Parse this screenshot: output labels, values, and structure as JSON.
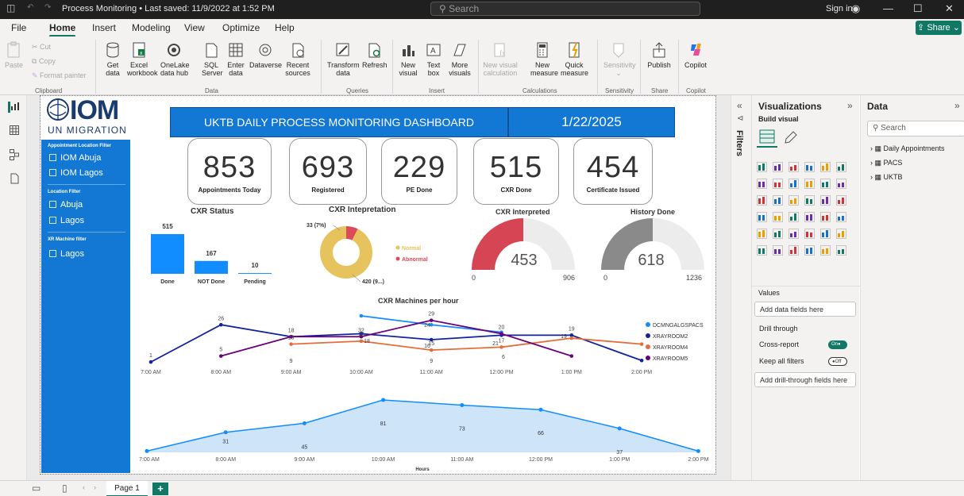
{
  "titlebar": {
    "title": "Process Monitoring • Last saved: 11/9/2022 at 1:52 PM",
    "search_placeholder": "Search",
    "sign_in": "Sign in"
  },
  "menu": {
    "items": [
      "File",
      "Home",
      "Insert",
      "Modeling",
      "View",
      "Optimize",
      "Help"
    ],
    "active": "Home",
    "share_label": "Share"
  },
  "ribbon": {
    "clipboard": {
      "paste": "Paste",
      "cut": "Cut",
      "copy": "Copy",
      "format_painter": "Format painter",
      "group": "Clipboard"
    },
    "data": {
      "get_data": [
        "Get",
        "data"
      ],
      "excel": [
        "Excel",
        "workbook"
      ],
      "onelake": [
        "OneLake",
        "data hub"
      ],
      "sql": [
        "SQL",
        "Server"
      ],
      "enter": [
        "Enter",
        "data"
      ],
      "dataverse": [
        "Dataverse",
        ""
      ],
      "recent": [
        "Recent",
        "sources"
      ],
      "group": "Data"
    },
    "queries": {
      "transform": [
        "Transform",
        "data"
      ],
      "refresh": [
        "Refresh",
        ""
      ],
      "group": "Queries"
    },
    "insert": {
      "new_visual": [
        "New",
        "visual"
      ],
      "text_box": [
        "Text",
        "box"
      ],
      "more_visuals": [
        "More",
        "visuals"
      ],
      "group": "Insert"
    },
    "calculations": {
      "new_visual_calc": [
        "New visual",
        "calculation"
      ],
      "new_measure": [
        "New",
        "measure"
      ],
      "quick_measure": [
        "Quick",
        "measure"
      ],
      "group": "Calculations"
    },
    "sensitivity": {
      "label": [
        "Sensitivity",
        ""
      ],
      "group": "Sensitivity"
    },
    "share": {
      "publish": [
        "Publish",
        ""
      ],
      "group": "Share"
    },
    "copilot": {
      "label": [
        "Copilot",
        ""
      ],
      "group": "Copilot"
    }
  },
  "report": {
    "logo": {
      "brand": "IOM",
      "sub": "UN MIGRATION"
    },
    "header": {
      "title": "UKTB DAILY PROCESS MONITORING DASHBOARD",
      "date": "1/22/2025"
    },
    "slicers": [
      {
        "title": "Appointment Location Filter",
        "options": [
          "IOM Abuja",
          "IOM Lagos"
        ]
      },
      {
        "title": "Location Filter",
        "options": [
          "Abuja",
          "Lagos"
        ]
      },
      {
        "title": "XR Machine filter",
        "options": [
          "Lagos"
        ]
      }
    ],
    "kpis": [
      {
        "value": "853",
        "label": "Appointments Today"
      },
      {
        "value": "693",
        "label": "Registered"
      },
      {
        "value": "229",
        "label": "PE Done"
      },
      {
        "value": "515",
        "label": "CXR Done"
      },
      {
        "value": "454",
        "label": "Certificate Issued"
      }
    ],
    "visual_titles": {
      "cxr_status": "CXR Status",
      "cxr_interpretation": "CXR Intepretation",
      "cxr_interpreted": "CXR Interpreted",
      "history_done": "History Done",
      "machines": "CXR Machines per hour"
    }
  },
  "chart_data": [
    {
      "type": "bar",
      "title": "CXR Status",
      "categories": [
        "Done",
        "NOT Done",
        "Pending"
      ],
      "values": [
        515,
        167,
        10
      ],
      "color": "#118dff"
    },
    {
      "type": "pie",
      "title": "CXR Intepretation",
      "variant": "donut",
      "slices": [
        {
          "name": "Normal",
          "value": 420,
          "label": "420 (9...)",
          "color": "#e6c35c"
        },
        {
          "name": "Abnormal",
          "value": 33,
          "label": "33 (7%)",
          "color": "#dc4b5a"
        }
      ],
      "legend": [
        "Normal",
        "Abnormal"
      ]
    },
    {
      "type": "gauge",
      "title": "CXR Interpreted",
      "value": 453,
      "min": 0,
      "max": 906,
      "color": "#d64554"
    },
    {
      "type": "gauge",
      "title": "History Done",
      "value": 618,
      "min": 0,
      "max": 1236,
      "color": "#8a8a8a"
    },
    {
      "type": "line",
      "title": "CXR Machines per hour",
      "x": [
        "7:00 AM",
        "8:00 AM",
        "9:00 AM",
        "10:00 AM",
        "11:00 AM",
        "12:00 PM",
        "1:00 PM",
        "2:00 PM"
      ],
      "series": [
        {
          "name": "DCMNGALGSPACS",
          "color": "#118dff",
          "values": [
            null,
            null,
            null,
            32,
            26,
            21,
            null,
            null
          ]
        },
        {
          "name": "XRAYROOM2",
          "color": "#12239e",
          "values": [
            1,
            26,
            18,
            20,
            16,
            19,
            19,
            2
          ]
        },
        {
          "name": "XRAYROOM4",
          "color": "#e66c37",
          "values": [
            null,
            null,
            13,
            15,
            9,
            11,
            17,
            13
          ]
        },
        {
          "name": "XRAYROOM5",
          "color": "#6b007b",
          "values": [
            null,
            5,
            18,
            18,
            29,
            20,
            5,
            null
          ]
        }
      ],
      "point_labels": [
        {
          "series": "XRAYROOM2",
          "labels": [
            "1",
            "26",
            "18",
            "",
            "",
            "",
            "19",
            ""
          ]
        },
        {
          "series": "XRAYROOM5",
          "labels": [
            "",
            "5",
            "",
            "32",
            "29",
            "20",
            "",
            ""
          ]
        },
        {
          "series": "XRAYROOM4",
          "labels": [
            "",
            "",
            "13",
            "20",
            "15",
            "17",
            "",
            ""
          ]
        },
        {
          "series": "other",
          "labels": [
            "",
            "",
            "9",
            "",
            "9",
            "",
            "",
            ""
          ]
        }
      ],
      "extra_labels": [
        "18",
        "24",
        "6",
        "21",
        "16",
        "19"
      ]
    },
    {
      "type": "area",
      "title": "",
      "xlabel": "Hours",
      "x": [
        "7:00 AM",
        "8:00 AM",
        "9:00 AM",
        "10:00 AM",
        "11:00 AM",
        "12:00 PM",
        "1:00 PM",
        "2:00 PM"
      ],
      "values": [
        null,
        31,
        45,
        81,
        73,
        66,
        37,
        null
      ],
      "color": "#118dff"
    }
  ],
  "panes": {
    "filters": "Filters",
    "visualizations": {
      "title": "Visualizations",
      "build": "Build visual",
      "values": "Values",
      "add_data": "Add data fields here",
      "drill": "Drill through",
      "cross_report": "Cross-report",
      "cross_state": "On",
      "keep_filters": "Keep all filters",
      "keep_state": "Off",
      "add_drill": "Add drill-through fields here"
    },
    "data": {
      "title": "Data",
      "search": "Search",
      "tables": [
        "Daily Appointments",
        "PACS",
        "UKTB"
      ]
    }
  },
  "statusbar": {
    "page": "Page 1"
  }
}
